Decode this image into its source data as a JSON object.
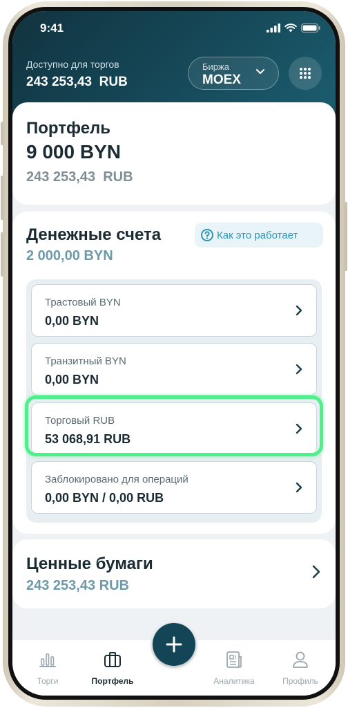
{
  "status": {
    "time": "9:41"
  },
  "header": {
    "available_label": "Доступно для торгов",
    "available_value": "243 253,43  RUB",
    "exchange_label": "Биржа",
    "exchange_value": "MOEX"
  },
  "portfolio": {
    "title": "Портфель",
    "value": "9 000 BYN",
    "sub_value": "243 253,43  RUB"
  },
  "cash_accounts": {
    "title": "Денежные счета",
    "value": "2 000,00 BYN",
    "how_it_works": "Как это работает",
    "accounts": [
      {
        "label": "Трастовый BYN",
        "value": "0,00 BYN"
      },
      {
        "label": "Транзитный BYN",
        "value": "0,00 BYN"
      },
      {
        "label": "Торговый RUB",
        "value": "53 068,91 RUB"
      },
      {
        "label": "Заблокировано для операций",
        "value": "0,00 BYN / 0,00 RUB"
      }
    ]
  },
  "securities": {
    "title": "Ценные бумаги",
    "value": "243 253,43 RUB"
  },
  "tabs": [
    {
      "label": "Торги",
      "icon": "bar-chart-icon"
    },
    {
      "label": "Портфель",
      "icon": "briefcase-icon",
      "active": true
    },
    {
      "label": "Аналитика",
      "icon": "news-icon"
    },
    {
      "label": "Профиль",
      "icon": "user-icon"
    }
  ],
  "colors": {
    "header": "#164a5a",
    "accent": "#6d9aa8",
    "highlight": "#4ff08a",
    "fab": "#144556"
  }
}
